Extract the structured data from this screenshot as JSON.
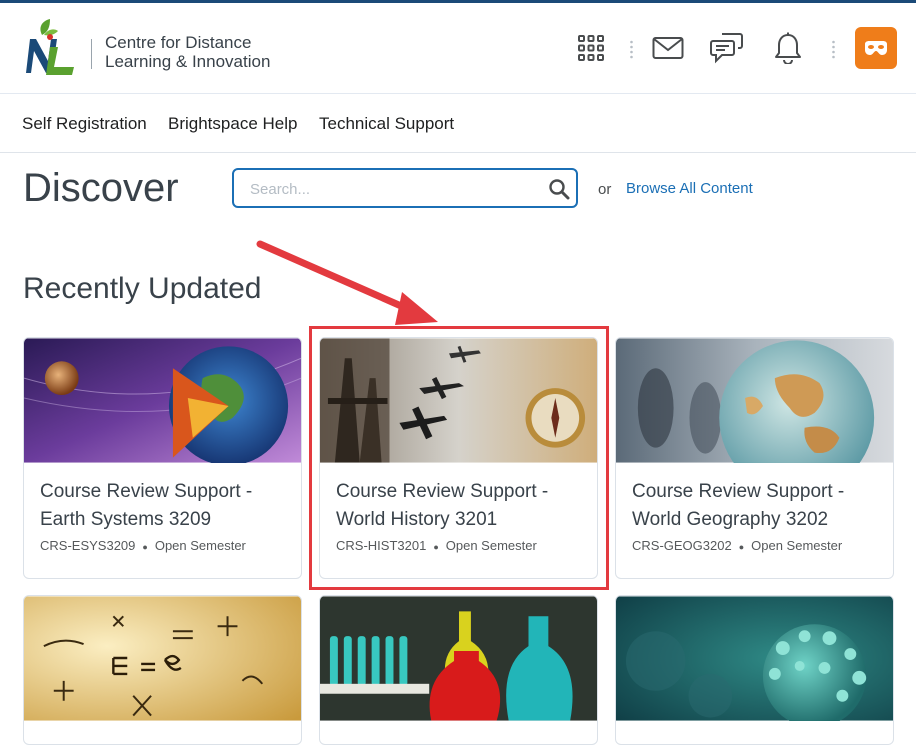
{
  "colors": {
    "brand_blue": "#1b4a78",
    "link_blue": "#1b6fb5",
    "avatar_orange": "#ef7d1a",
    "annotation_red": "#e33a3f"
  },
  "header": {
    "logo_icon": "nl-logo",
    "org_name_line1": "Centre for Distance",
    "org_name_line2": "Learning & Innovation",
    "icons": [
      "waffle-grid-icon",
      "email-icon",
      "message-alerts-icon",
      "notification-bell-icon"
    ],
    "avatar_icon": "mask-avatar-icon"
  },
  "nav": {
    "items": [
      {
        "label": "Self Registration"
      },
      {
        "label": "Brightspace Help"
      },
      {
        "label": "Technical Support"
      }
    ]
  },
  "discover": {
    "title": "Discover",
    "search": {
      "placeholder": "Search...",
      "value": ""
    },
    "or_text": "or",
    "browse_link": "Browse All Content"
  },
  "recently_updated": {
    "title": "Recently Updated",
    "cards": [
      {
        "title_line1": "Course Review Support -",
        "title_line2": "Earth Systems 3209",
        "code": "CRS-ESYS3209",
        "semester": "Open Semester",
        "image": "earth-systems-image"
      },
      {
        "title_line1": "Course Review Support -",
        "title_line2": "World History 3201",
        "code": "CRS-HIST3201",
        "semester": "Open Semester",
        "image": "world-history-image",
        "highlighted": true
      },
      {
        "title_line1": "Course Review Support -",
        "title_line2": "World Geography 3202",
        "code": "CRS-GEOG3202",
        "semester": "Open Semester",
        "image": "world-geography-image"
      },
      {
        "title_line1": "",
        "title_line2": "",
        "code": "",
        "semester": "",
        "image": "physics-formulas-image"
      },
      {
        "title_line1": "",
        "title_line2": "",
        "code": "",
        "semester": "",
        "image": "chemistry-lab-image"
      },
      {
        "title_line1": "",
        "title_line2": "",
        "code": "",
        "semester": "",
        "image": "biology-virus-image"
      }
    ]
  }
}
